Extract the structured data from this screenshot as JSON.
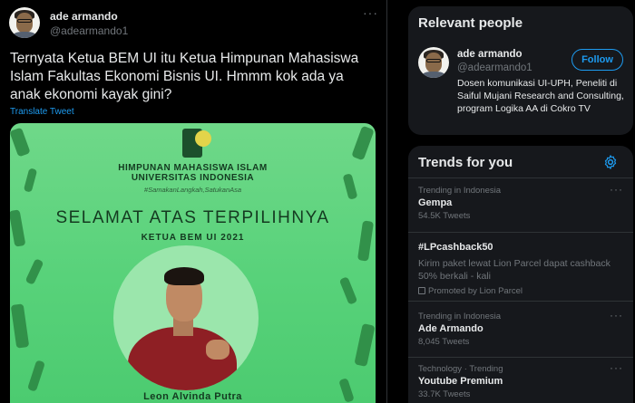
{
  "tweet": {
    "author_name": "ade armando",
    "author_handle": "@adearmando1",
    "more_label": "···",
    "text": "Ternyata Ketua BEM UI itu Ketua Himpunan Mahasiswa Islam Fakultas Ekonomi Bisnis UI. Hmmm kok ada ya anak ekonomi kayak gini?",
    "translate_label": "Translate Tweet",
    "poster": {
      "org_line1": "HIMPUNAN MAHASISWA ISLAM",
      "org_line2": "UNIVERSITAS INDONESIA",
      "hashtag": "#SamakanLangkah,SatukanAsa",
      "headline": "SELAMAT ATAS TERPILIHNYA",
      "subheadline": "KETUA BEM UI 2021",
      "person_name": "Leon Alvinda Putra"
    }
  },
  "relevant_people": {
    "title": "Relevant people",
    "name": "ade armando",
    "handle": "@adearmando1",
    "follow_label": "Follow",
    "bio": "Dosen komunikasi UI-UPH, Peneliti di Saiful Mujani Research and Consulting, program Logika AA di Cokro TV"
  },
  "trends": {
    "title": "Trends for you",
    "more_label": "···",
    "items": [
      {
        "context": "Trending in Indonesia",
        "name": "Gempa",
        "count": "54.5K Tweets"
      },
      {
        "name": "#LPcashback50",
        "description": "Kirim paket lewat Lion Parcel dapat cashback 50% berkali - kali",
        "promoted": "Promoted by Lion Parcel"
      },
      {
        "context": "Trending in Indonesia",
        "name": "Ade Armando",
        "count": "8,045 Tweets"
      },
      {
        "context": "Technology · Trending",
        "name": "Youtube Premium",
        "count": "33.7K Tweets"
      }
    ]
  },
  "colors": {
    "background": "#000000",
    "card": "#16181c",
    "accent": "#1d9bf0",
    "poster_green": "#58d27a"
  },
  "icons": [
    "more-horizontal-icon",
    "settings-gear-icon",
    "promoted-icon"
  ]
}
